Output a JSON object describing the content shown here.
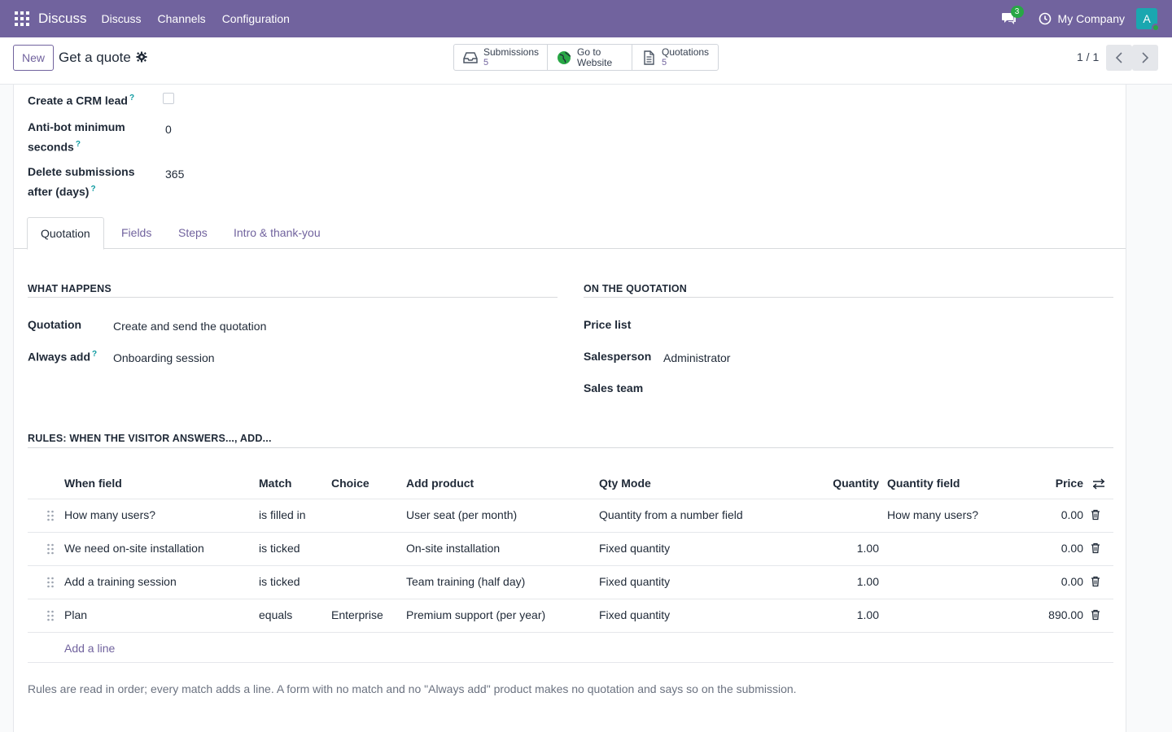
{
  "navbar": {
    "brand": "Discuss",
    "menu": [
      "Discuss",
      "Channels",
      "Configuration"
    ],
    "chat_badge": "3",
    "company": "My Company",
    "avatar_letter": "A"
  },
  "control": {
    "new_label": "New",
    "title": "Get a quote",
    "smart_buttons": [
      {
        "line1": "Submissions",
        "line2": "5"
      },
      {
        "line1": "Go to",
        "line2": "Website"
      },
      {
        "line1": "Quotations",
        "line2": "5"
      }
    ],
    "pager": "1 / 1"
  },
  "fields": {
    "crm_lead_label": "Create a CRM lead",
    "antibot_label_1": "Anti-bot minimum",
    "antibot_label_2": "seconds",
    "antibot_value": "0",
    "delete_label_1": "Delete submissions",
    "delete_label_2": "after (days)",
    "delete_value": "365",
    "help_mark": "?"
  },
  "tabs": [
    "Quotation",
    "Fields",
    "Steps",
    "Intro & thank-you"
  ],
  "what_happens": {
    "title": "WHAT HAPPENS",
    "quotation_label": "Quotation",
    "quotation_value": "Create and send the quotation",
    "always_add_label": "Always add",
    "always_add_value": "Onboarding session"
  },
  "on_quotation": {
    "title": "ON THE QUOTATION",
    "price_list_label": "Price list",
    "salesperson_label": "Salesperson",
    "salesperson_value": "Administrator",
    "sales_team_label": "Sales team"
  },
  "rules": {
    "title": "RULES: WHEN THE VISITOR ANSWERS..., ADD...",
    "headers": {
      "when_field": "When field",
      "match": "Match",
      "choice": "Choice",
      "add_product": "Add product",
      "qty_mode": "Qty Mode",
      "quantity": "Quantity",
      "quantity_field": "Quantity field",
      "price": "Price"
    },
    "rows": [
      {
        "when_field": "How many users?",
        "match": "is filled in",
        "choice": "",
        "add_product": "User seat (per month)",
        "qty_mode": "Quantity from a number field",
        "quantity": "",
        "quantity_field": "How many users?",
        "price": "0.00"
      },
      {
        "when_field": "We need on-site installation",
        "match": "is ticked",
        "choice": "",
        "add_product": "On-site installation",
        "qty_mode": "Fixed quantity",
        "quantity": "1.00",
        "quantity_field": "",
        "price": "0.00"
      },
      {
        "when_field": "Add a training session",
        "match": "is ticked",
        "choice": "",
        "add_product": "Team training (half day)",
        "qty_mode": "Fixed quantity",
        "quantity": "1.00",
        "quantity_field": "",
        "price": "0.00"
      },
      {
        "when_field": "Plan",
        "match": "equals",
        "choice": "Enterprise",
        "add_product": "Premium support (per year)",
        "qty_mode": "Fixed quantity",
        "quantity": "1.00",
        "quantity_field": "",
        "price": "890.00"
      }
    ],
    "add_line": "Add a line",
    "note": "Rules are read in order; every match adds a line. A form with no match and no \"Always add\" product makes no quotation and says so on the submission."
  }
}
